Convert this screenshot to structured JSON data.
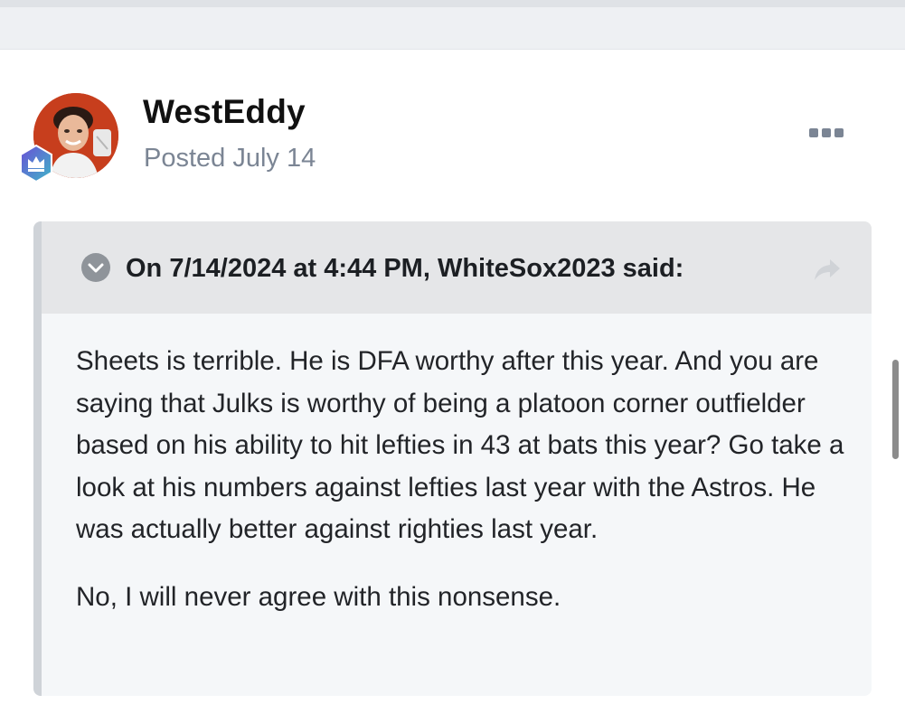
{
  "post": {
    "author": "WestEddy",
    "date": "Posted July 14",
    "avatar_icon": "avatar-photo",
    "rank_badge_icon": "crown-icon",
    "more_icon": "ellipsis-icon"
  },
  "quote": {
    "citation": "On 7/14/2024 at 4:44 PM, WhiteSox2023 said:",
    "toggle_icon": "chevron-down-icon",
    "share_icon": "share-arrow-icon",
    "paragraphs": [
      "Sheets is terrible.  He is DFA worthy after this year.  And you are saying that Julks is worthy of being a platoon corner outfielder based on his ability to hit lefties in 43 at bats this year?  Go take a look at his numbers against lefties last year with the Astros.  He was actually better against righties last year.",
      "No, I will never agree with this nonsense."
    ]
  },
  "colors": {
    "badge_gradient_start": "#6a4fd6",
    "badge_gradient_end": "#3fb6c8",
    "meta_text": "#7b8594",
    "quote_border": "#cfd3d8"
  }
}
